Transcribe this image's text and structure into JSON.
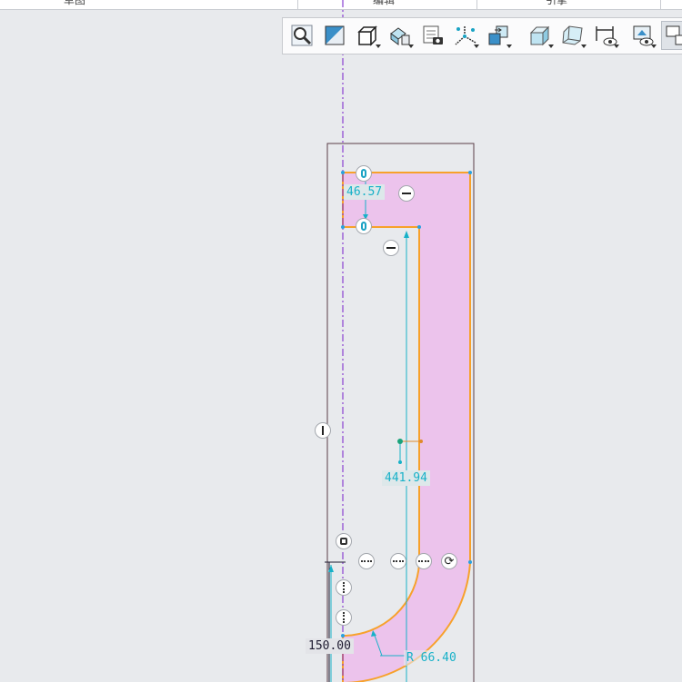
{
  "ribbon": {
    "tabs": [
      "草图",
      "编辑",
      "引擎"
    ]
  },
  "toolbar": {
    "tools": [
      {
        "name": "zoom-icon"
      },
      {
        "name": "sketch-plane-icon"
      },
      {
        "name": "view-orientation-icon",
        "caret": true
      },
      {
        "name": "render-style-icon",
        "caret": true
      },
      {
        "name": "snapshot-icon"
      },
      {
        "name": "coordinate-axes-icon",
        "caret": true
      },
      {
        "name": "transform-icon",
        "caret": true
      },
      {
        "name": "solid-box-icon",
        "caret": true
      },
      {
        "name": "transparent-box-icon",
        "caret": true
      },
      {
        "name": "dimension-visibility-icon",
        "caret": true
      },
      {
        "name": "display-filter-icon",
        "caret": true
      },
      {
        "name": "window-layout-icon",
        "active": true
      }
    ]
  },
  "colors": {
    "profile_fill": "#ecc3ec",
    "profile_edge": "#f7a12b",
    "dimension": "#17b1c8",
    "construction_axis": "#8a3fd1",
    "frame": "#5a3d46"
  },
  "dimensions": {
    "top_width": "46.57",
    "inner_height": "441.94",
    "radius": "R 66.40",
    "lower_width": "150.00"
  }
}
